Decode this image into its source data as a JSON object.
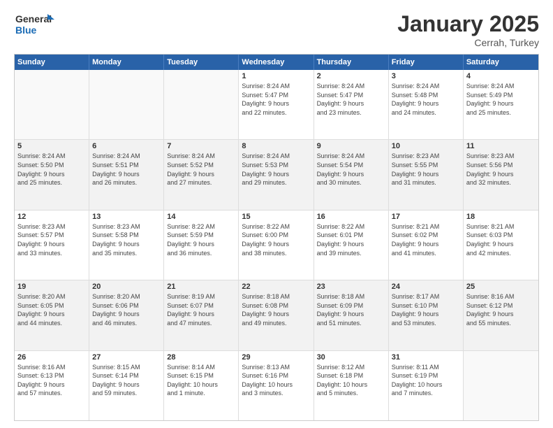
{
  "logo": {
    "line1": "General",
    "line2": "Blue"
  },
  "header": {
    "title": "January 2025",
    "subtitle": "Cerrah, Turkey"
  },
  "weekdays": [
    "Sunday",
    "Monday",
    "Tuesday",
    "Wednesday",
    "Thursday",
    "Friday",
    "Saturday"
  ],
  "rows": [
    [
      {
        "day": "",
        "sunrise": "",
        "sunset": "",
        "daylight": "",
        "empty": true
      },
      {
        "day": "",
        "sunrise": "",
        "sunset": "",
        "daylight": "",
        "empty": true
      },
      {
        "day": "",
        "sunrise": "",
        "sunset": "",
        "daylight": "",
        "empty": true
      },
      {
        "day": "1",
        "text": "Sunrise: 8:24 AM\nSunset: 5:47 PM\nDaylight: 9 hours\nand 22 minutes."
      },
      {
        "day": "2",
        "text": "Sunrise: 8:24 AM\nSunset: 5:47 PM\nDaylight: 9 hours\nand 23 minutes."
      },
      {
        "day": "3",
        "text": "Sunrise: 8:24 AM\nSunset: 5:48 PM\nDaylight: 9 hours\nand 24 minutes."
      },
      {
        "day": "4",
        "text": "Sunrise: 8:24 AM\nSunset: 5:49 PM\nDaylight: 9 hours\nand 25 minutes."
      }
    ],
    [
      {
        "day": "5",
        "text": "Sunrise: 8:24 AM\nSunset: 5:50 PM\nDaylight: 9 hours\nand 25 minutes."
      },
      {
        "day": "6",
        "text": "Sunrise: 8:24 AM\nSunset: 5:51 PM\nDaylight: 9 hours\nand 26 minutes."
      },
      {
        "day": "7",
        "text": "Sunrise: 8:24 AM\nSunset: 5:52 PM\nDaylight: 9 hours\nand 27 minutes."
      },
      {
        "day": "8",
        "text": "Sunrise: 8:24 AM\nSunset: 5:53 PM\nDaylight: 9 hours\nand 29 minutes."
      },
      {
        "day": "9",
        "text": "Sunrise: 8:24 AM\nSunset: 5:54 PM\nDaylight: 9 hours\nand 30 minutes."
      },
      {
        "day": "10",
        "text": "Sunrise: 8:23 AM\nSunset: 5:55 PM\nDaylight: 9 hours\nand 31 minutes."
      },
      {
        "day": "11",
        "text": "Sunrise: 8:23 AM\nSunset: 5:56 PM\nDaylight: 9 hours\nand 32 minutes."
      }
    ],
    [
      {
        "day": "12",
        "text": "Sunrise: 8:23 AM\nSunset: 5:57 PM\nDaylight: 9 hours\nand 33 minutes."
      },
      {
        "day": "13",
        "text": "Sunrise: 8:23 AM\nSunset: 5:58 PM\nDaylight: 9 hours\nand 35 minutes."
      },
      {
        "day": "14",
        "text": "Sunrise: 8:22 AM\nSunset: 5:59 PM\nDaylight: 9 hours\nand 36 minutes."
      },
      {
        "day": "15",
        "text": "Sunrise: 8:22 AM\nSunset: 6:00 PM\nDaylight: 9 hours\nand 38 minutes."
      },
      {
        "day": "16",
        "text": "Sunrise: 8:22 AM\nSunset: 6:01 PM\nDaylight: 9 hours\nand 39 minutes."
      },
      {
        "day": "17",
        "text": "Sunrise: 8:21 AM\nSunset: 6:02 PM\nDaylight: 9 hours\nand 41 minutes."
      },
      {
        "day": "18",
        "text": "Sunrise: 8:21 AM\nSunset: 6:03 PM\nDaylight: 9 hours\nand 42 minutes."
      }
    ],
    [
      {
        "day": "19",
        "text": "Sunrise: 8:20 AM\nSunset: 6:05 PM\nDaylight: 9 hours\nand 44 minutes."
      },
      {
        "day": "20",
        "text": "Sunrise: 8:20 AM\nSunset: 6:06 PM\nDaylight: 9 hours\nand 46 minutes."
      },
      {
        "day": "21",
        "text": "Sunrise: 8:19 AM\nSunset: 6:07 PM\nDaylight: 9 hours\nand 47 minutes."
      },
      {
        "day": "22",
        "text": "Sunrise: 8:18 AM\nSunset: 6:08 PM\nDaylight: 9 hours\nand 49 minutes."
      },
      {
        "day": "23",
        "text": "Sunrise: 8:18 AM\nSunset: 6:09 PM\nDaylight: 9 hours\nand 51 minutes."
      },
      {
        "day": "24",
        "text": "Sunrise: 8:17 AM\nSunset: 6:10 PM\nDaylight: 9 hours\nand 53 minutes."
      },
      {
        "day": "25",
        "text": "Sunrise: 8:16 AM\nSunset: 6:12 PM\nDaylight: 9 hours\nand 55 minutes."
      }
    ],
    [
      {
        "day": "26",
        "text": "Sunrise: 8:16 AM\nSunset: 6:13 PM\nDaylight: 9 hours\nand 57 minutes."
      },
      {
        "day": "27",
        "text": "Sunrise: 8:15 AM\nSunset: 6:14 PM\nDaylight: 9 hours\nand 59 minutes."
      },
      {
        "day": "28",
        "text": "Sunrise: 8:14 AM\nSunset: 6:15 PM\nDaylight: 10 hours\nand 1 minute."
      },
      {
        "day": "29",
        "text": "Sunrise: 8:13 AM\nSunset: 6:16 PM\nDaylight: 10 hours\nand 3 minutes."
      },
      {
        "day": "30",
        "text": "Sunrise: 8:12 AM\nSunset: 6:18 PM\nDaylight: 10 hours\nand 5 minutes."
      },
      {
        "day": "31",
        "text": "Sunrise: 8:11 AM\nSunset: 6:19 PM\nDaylight: 10 hours\nand 7 minutes."
      },
      {
        "day": "",
        "text": "",
        "empty": true
      }
    ]
  ]
}
